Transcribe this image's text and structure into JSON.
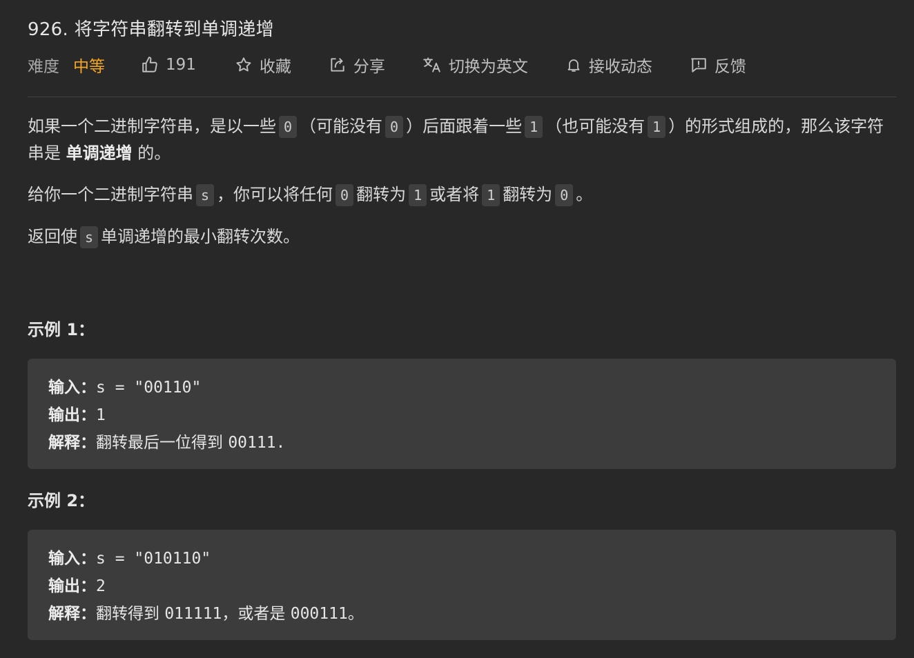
{
  "problem": {
    "title": "926. 将字符串翻转到单调递增"
  },
  "toolbar": {
    "difficulty_label": "难度",
    "difficulty_value": "中等",
    "difficulty_color": "#f5a623",
    "likes_count": "191",
    "favorite_label": "收藏",
    "share_label": "分享",
    "translate_label": "切换为英文",
    "subscribe_label": "接收动态",
    "feedback_label": "反馈",
    "icons": [
      "thumbs-up-icon",
      "star-icon",
      "share-icon",
      "translate-icon",
      "bell-icon",
      "feedback-icon"
    ]
  },
  "description": {
    "p1_a": "如果一个二进制字符串，是以一些",
    "p1_code1": "0",
    "p1_b": "（可能没有",
    "p1_code2": "0",
    "p1_c": "）后面跟着一些",
    "p1_code3": "1",
    "p1_d": "（也可能没有",
    "p1_code4": "1",
    "p1_e": "）的形式组成的，那么该字符串是",
    "p1_strong": "单调递增",
    "p1_f": "的。",
    "p2_a": "给你一个二进制字符串",
    "p2_code1": "s",
    "p2_b": "，你可以将任何",
    "p2_code2": "0",
    "p2_c": "翻转为",
    "p2_code3": "1",
    "p2_d": "或者将",
    "p2_code4": "1",
    "p2_e": "翻转为",
    "p2_code5": "0",
    "p2_f": "。",
    "p3_a": "返回使",
    "p3_code1": "s",
    "p3_b": "单调递增的最小翻转次数。"
  },
  "examples": [
    {
      "title": "示例 1：",
      "input_label": "输入：",
      "input_value": "s = \"00110\"",
      "output_label": "输出：",
      "output_value": "1",
      "explain_label": "解释：",
      "explain_text": "翻转最后一位得到",
      "explain_code": "00111."
    },
    {
      "title": "示例 2：",
      "input_label": "输入：",
      "input_value": "s = \"010110\"",
      "output_label": "输出：",
      "output_value": "2",
      "explain_label": "解释：",
      "explain_text": "翻转得到",
      "explain_code": "011111",
      "explain_text2": "，或者是",
      "explain_code2": "000111",
      "explain_text3": "。"
    }
  ]
}
